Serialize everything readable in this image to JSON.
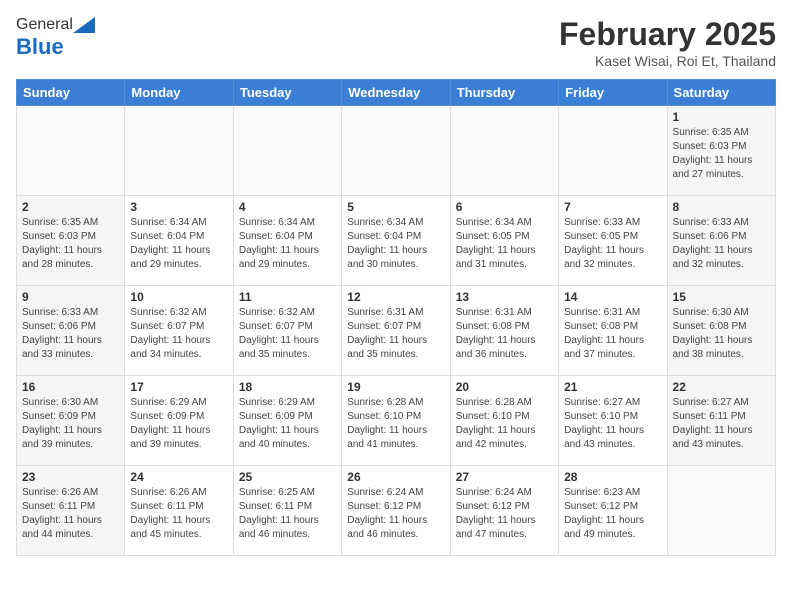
{
  "header": {
    "logo_general": "General",
    "logo_blue": "Blue",
    "month_title": "February 2025",
    "location": "Kaset Wisai, Roi Et, Thailand"
  },
  "weekdays": [
    "Sunday",
    "Monday",
    "Tuesday",
    "Wednesday",
    "Thursday",
    "Friday",
    "Saturday"
  ],
  "weeks": [
    [
      {
        "day": "",
        "info": ""
      },
      {
        "day": "",
        "info": ""
      },
      {
        "day": "",
        "info": ""
      },
      {
        "day": "",
        "info": ""
      },
      {
        "day": "",
        "info": ""
      },
      {
        "day": "",
        "info": ""
      },
      {
        "day": "1",
        "info": "Sunrise: 6:35 AM\nSunset: 6:03 PM\nDaylight: 11 hours\nand 27 minutes."
      }
    ],
    [
      {
        "day": "2",
        "info": "Sunrise: 6:35 AM\nSunset: 6:03 PM\nDaylight: 11 hours\nand 28 minutes."
      },
      {
        "day": "3",
        "info": "Sunrise: 6:34 AM\nSunset: 6:04 PM\nDaylight: 11 hours\nand 29 minutes."
      },
      {
        "day": "4",
        "info": "Sunrise: 6:34 AM\nSunset: 6:04 PM\nDaylight: 11 hours\nand 29 minutes."
      },
      {
        "day": "5",
        "info": "Sunrise: 6:34 AM\nSunset: 6:04 PM\nDaylight: 11 hours\nand 30 minutes."
      },
      {
        "day": "6",
        "info": "Sunrise: 6:34 AM\nSunset: 6:05 PM\nDaylight: 11 hours\nand 31 minutes."
      },
      {
        "day": "7",
        "info": "Sunrise: 6:33 AM\nSunset: 6:05 PM\nDaylight: 11 hours\nand 32 minutes."
      },
      {
        "day": "8",
        "info": "Sunrise: 6:33 AM\nSunset: 6:06 PM\nDaylight: 11 hours\nand 32 minutes."
      }
    ],
    [
      {
        "day": "9",
        "info": "Sunrise: 6:33 AM\nSunset: 6:06 PM\nDaylight: 11 hours\nand 33 minutes."
      },
      {
        "day": "10",
        "info": "Sunrise: 6:32 AM\nSunset: 6:07 PM\nDaylight: 11 hours\nand 34 minutes."
      },
      {
        "day": "11",
        "info": "Sunrise: 6:32 AM\nSunset: 6:07 PM\nDaylight: 11 hours\nand 35 minutes."
      },
      {
        "day": "12",
        "info": "Sunrise: 6:31 AM\nSunset: 6:07 PM\nDaylight: 11 hours\nand 35 minutes."
      },
      {
        "day": "13",
        "info": "Sunrise: 6:31 AM\nSunset: 6:08 PM\nDaylight: 11 hours\nand 36 minutes."
      },
      {
        "day": "14",
        "info": "Sunrise: 6:31 AM\nSunset: 6:08 PM\nDaylight: 11 hours\nand 37 minutes."
      },
      {
        "day": "15",
        "info": "Sunrise: 6:30 AM\nSunset: 6:08 PM\nDaylight: 11 hours\nand 38 minutes."
      }
    ],
    [
      {
        "day": "16",
        "info": "Sunrise: 6:30 AM\nSunset: 6:09 PM\nDaylight: 11 hours\nand 39 minutes."
      },
      {
        "day": "17",
        "info": "Sunrise: 6:29 AM\nSunset: 6:09 PM\nDaylight: 11 hours\nand 39 minutes."
      },
      {
        "day": "18",
        "info": "Sunrise: 6:29 AM\nSunset: 6:09 PM\nDaylight: 11 hours\nand 40 minutes."
      },
      {
        "day": "19",
        "info": "Sunrise: 6:28 AM\nSunset: 6:10 PM\nDaylight: 11 hours\nand 41 minutes."
      },
      {
        "day": "20",
        "info": "Sunrise: 6:28 AM\nSunset: 6:10 PM\nDaylight: 11 hours\nand 42 minutes."
      },
      {
        "day": "21",
        "info": "Sunrise: 6:27 AM\nSunset: 6:10 PM\nDaylight: 11 hours\nand 43 minutes."
      },
      {
        "day": "22",
        "info": "Sunrise: 6:27 AM\nSunset: 6:11 PM\nDaylight: 11 hours\nand 43 minutes."
      }
    ],
    [
      {
        "day": "23",
        "info": "Sunrise: 6:26 AM\nSunset: 6:11 PM\nDaylight: 11 hours\nand 44 minutes."
      },
      {
        "day": "24",
        "info": "Sunrise: 6:26 AM\nSunset: 6:11 PM\nDaylight: 11 hours\nand 45 minutes."
      },
      {
        "day": "25",
        "info": "Sunrise: 6:25 AM\nSunset: 6:11 PM\nDaylight: 11 hours\nand 46 minutes."
      },
      {
        "day": "26",
        "info": "Sunrise: 6:24 AM\nSunset: 6:12 PM\nDaylight: 11 hours\nand 46 minutes."
      },
      {
        "day": "27",
        "info": "Sunrise: 6:24 AM\nSunset: 6:12 PM\nDaylight: 11 hours\nand 47 minutes."
      },
      {
        "day": "28",
        "info": "Sunrise: 6:23 AM\nSunset: 6:12 PM\nDaylight: 11 hours\nand 49 minutes."
      },
      {
        "day": "",
        "info": ""
      }
    ]
  ]
}
